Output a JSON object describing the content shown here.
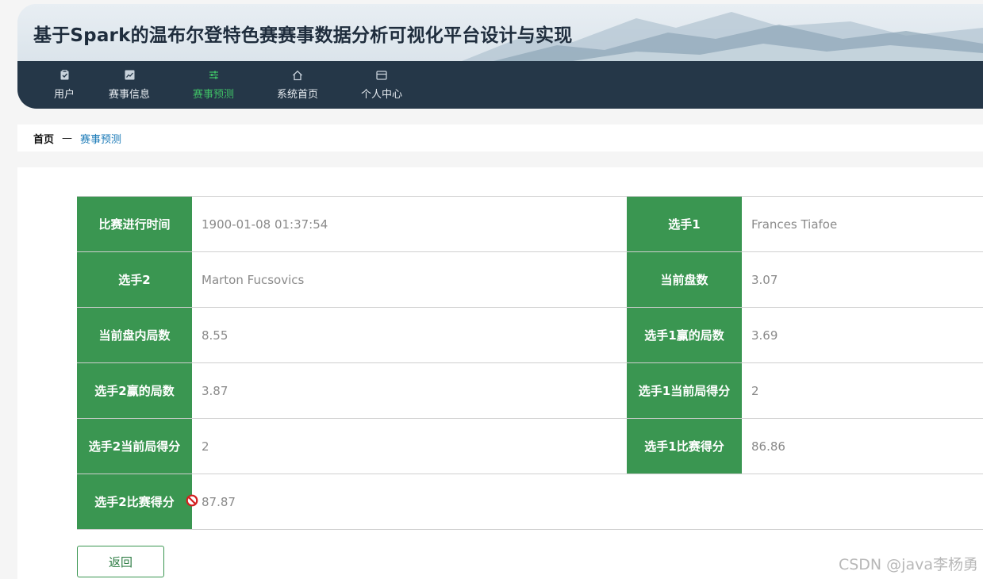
{
  "header": {
    "title": "基于Spark的温布尔登特色赛赛事数据分析可视化平台设计与实现"
  },
  "nav": {
    "items": [
      {
        "label": "用户",
        "icon": "clipboard-icon"
      },
      {
        "label": "赛事信息",
        "icon": "chart-icon"
      },
      {
        "label": "赛事预测",
        "icon": "sliders-icon"
      },
      {
        "label": "系统首页",
        "icon": "home-icon"
      },
      {
        "label": "个人中心",
        "icon": "card-icon"
      }
    ],
    "active": "赛事预测",
    "active_color": "#3fbf66"
  },
  "breadcrumb": {
    "home": "首页",
    "separator": "—",
    "current": "赛事预测"
  },
  "detail": {
    "rows": [
      {
        "l_label": "比赛进行时间",
        "l_value": "1900-01-08 01:37:54",
        "r_label": "选手1",
        "r_value": "Frances Tiafoe"
      },
      {
        "l_label": "选手2",
        "l_value": "Marton Fucsovics",
        "r_label": "当前盘数",
        "r_value": "3.07"
      },
      {
        "l_label": "当前盘内局数",
        "l_value": "8.55",
        "r_label": "选手1赢的局数",
        "r_value": "3.69"
      },
      {
        "l_label": "选手2赢的局数",
        "l_value": "3.87",
        "r_label": "选手1当前局得分",
        "r_value": "2"
      },
      {
        "l_label": "选手2当前局得分",
        "l_value": "2",
        "r_label": "选手1比赛得分",
        "r_value": "86.86"
      },
      {
        "l_label": "选手2比赛得分",
        "l_value": "87.87"
      }
    ],
    "label_bg": "#3a9651"
  },
  "actions": {
    "back_label": "返回"
  },
  "watermark": "CSDN @java李杨勇"
}
